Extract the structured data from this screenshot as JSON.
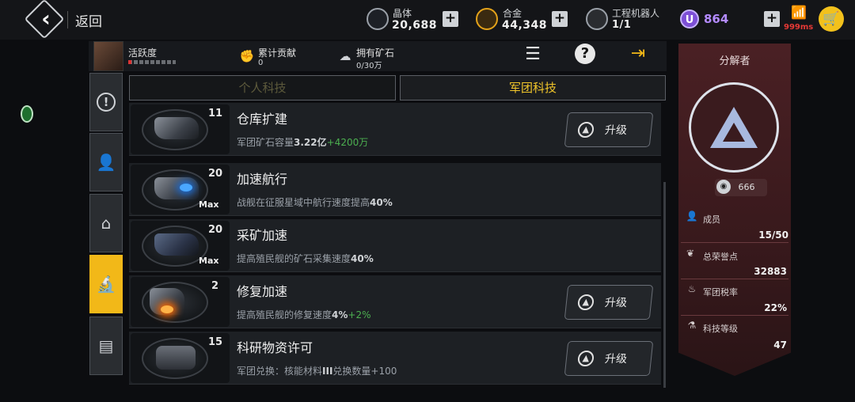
{
  "topbar": {
    "back_label": "返回",
    "resources": [
      {
        "name": "晶体",
        "value": "20,688",
        "icon": "crystal-icon"
      },
      {
        "name": "合金",
        "value": "44,348",
        "icon": "alloy-icon"
      },
      {
        "name": "工程机器人",
        "value": "1/1",
        "icon": "robot-icon"
      }
    ],
    "u_currency": {
      "icon_text": "U",
      "value": "864"
    },
    "ping": "999ms"
  },
  "header": {
    "activity_label": "活跃度",
    "activity_progress": 0.07,
    "stats": [
      {
        "name": "累计贡献",
        "value": "0",
        "icon": "fist-icon"
      },
      {
        "name": "拥有矿石",
        "value": "0/30万",
        "icon": "ore-icon"
      }
    ]
  },
  "tabs": [
    {
      "label": "个人科技",
      "active": false
    },
    {
      "label": "军团科技",
      "active": true
    }
  ],
  "rail": [
    {
      "icon": "alert-icon",
      "glyph": "!"
    },
    {
      "icon": "member-icon",
      "glyph": "👤"
    },
    {
      "icon": "building-icon",
      "glyph": "🏛"
    },
    {
      "icon": "microscope-icon",
      "glyph": "🔬"
    },
    {
      "icon": "card-icon",
      "glyph": "🗂"
    }
  ],
  "tech_items": [
    {
      "title": "仓库扩建",
      "level": "11",
      "max": "",
      "desc_prefix": "军团矿石容量",
      "desc_value": "3.22亿",
      "desc_gain": "+4200万",
      "upgrade": "升级"
    },
    {
      "title": "加速航行",
      "level": "20",
      "max": "Max",
      "desc_prefix": "战舰在征服星域中航行速度提高",
      "desc_value": "40%",
      "desc_gain": "",
      "upgrade": ""
    },
    {
      "title": "采矿加速",
      "level": "20",
      "max": "Max",
      "desc_prefix": "提高殖民舰的矿石采集速度",
      "desc_value": "40%",
      "desc_gain": "",
      "upgrade": ""
    },
    {
      "title": "修复加速",
      "level": "2",
      "max": "",
      "desc_prefix": "提高殖民舰的修复速度",
      "desc_value": "4%",
      "desc_gain": "+2%",
      "upgrade": "升级"
    },
    {
      "title": "科研物资许可",
      "level": "15",
      "max": "",
      "desc_prefix": "军团兑换：核能材料",
      "desc_value": "III",
      "desc_gain": "",
      "desc_suffix": "兑换数量+100",
      "upgrade": "升级"
    }
  ],
  "panel": {
    "title": "分解者",
    "rank": "666",
    "stats": [
      {
        "label": "成员",
        "value": "15/50",
        "icon": "member-icon"
      },
      {
        "label": "总荣誉点",
        "value": "32883",
        "icon": "wings-icon"
      },
      {
        "label": "军团税率",
        "value": "22%",
        "icon": "tax-icon"
      },
      {
        "label": "科技等级",
        "value": "47",
        "icon": "microscope-icon"
      }
    ]
  },
  "colors": {
    "accent": "#f2b818",
    "panel": "#4a2024",
    "gain": "#4caf50",
    "purple": "#b48bff",
    "ping": "#e53935"
  }
}
